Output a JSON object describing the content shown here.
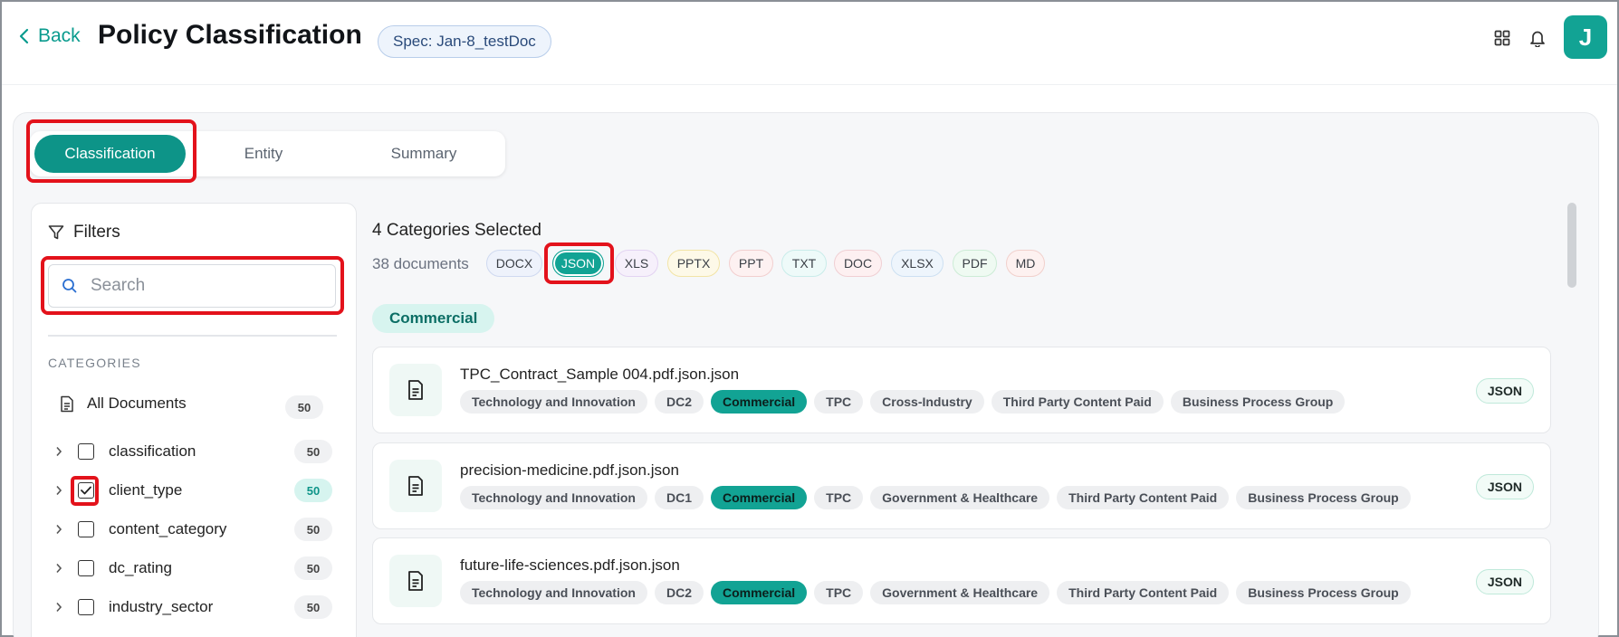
{
  "header": {
    "back_label": "Back",
    "title": "Policy Classification",
    "spec_chip": "Spec: Jan-8_testDoc",
    "avatar_initial": "J",
    "icons": [
      "grid-icon",
      "bell-icon"
    ]
  },
  "tabs": [
    {
      "label": "Classification",
      "active": true
    },
    {
      "label": "Entity",
      "active": false
    },
    {
      "label": "Summary",
      "active": false
    }
  ],
  "filters": {
    "title": "Filters",
    "search_placeholder": "Search",
    "categories_label": "CATEGORIES",
    "all_documents": {
      "label": "All Documents",
      "count": "50"
    },
    "items": [
      {
        "label": "classification",
        "count": "50",
        "checked": false
      },
      {
        "label": "client_type",
        "count": "50",
        "checked": true
      },
      {
        "label": "content_category",
        "count": "50",
        "checked": false
      },
      {
        "label": "dc_rating",
        "count": "50",
        "checked": false
      },
      {
        "label": "industry_sector",
        "count": "50",
        "checked": false
      }
    ]
  },
  "content": {
    "categories_selected": "4 Categories Selected",
    "doc_count": "38 documents",
    "file_types": [
      {
        "label": "DOCX",
        "selected": false,
        "bg": "#eef2fb",
        "border": "#cfd9f0"
      },
      {
        "label": "JSON",
        "selected": true,
        "bg": "#12a394",
        "border": "#12a394"
      },
      {
        "label": "XLS",
        "selected": false,
        "bg": "#f6f0fb",
        "border": "#e3d3f2"
      },
      {
        "label": "PPTX",
        "selected": false,
        "bg": "#fdf9e8",
        "border": "#f2e4a6"
      },
      {
        "label": "PPT",
        "selected": false,
        "bg": "#fdf1f1",
        "border": "#f2cfcf"
      },
      {
        "label": "TXT",
        "selected": false,
        "bg": "#eefaf9",
        "border": "#c9ecea"
      },
      {
        "label": "DOC",
        "selected": false,
        "bg": "#fdf0f1",
        "border": "#f0cfd3"
      },
      {
        "label": "XLSX",
        "selected": false,
        "bg": "#eef5fc",
        "border": "#cde0f2"
      },
      {
        "label": "PDF",
        "selected": false,
        "bg": "#effaf2",
        "border": "#cdecd6"
      },
      {
        "label": "MD",
        "selected": false,
        "bg": "#fdf1f0",
        "border": "#f1d0cc"
      }
    ],
    "group_label": "Commercial",
    "documents": [
      {
        "name": "TPC_Contract_Sample 004.pdf.json.json",
        "tags": [
          "Technology and Innovation",
          "DC2",
          "Commercial",
          "TPC",
          "Cross-Industry",
          "Third Party Content Paid",
          "Business Process Group"
        ],
        "format": "JSON"
      },
      {
        "name": "precision-medicine.pdf.json.json",
        "tags": [
          "Technology and Innovation",
          "DC1",
          "Commercial",
          "TPC",
          "Government & Healthcare",
          "Third Party Content Paid",
          "Business Process Group"
        ],
        "format": "JSON"
      },
      {
        "name": "future-life-sciences.pdf.json.json",
        "tags": [
          "Technology and Innovation",
          "DC2",
          "Commercial",
          "TPC",
          "Government & Healthcare",
          "Third Party Content Paid",
          "Business Process Group"
        ],
        "format": "JSON"
      }
    ]
  },
  "colors": {
    "accent": "#0d9488",
    "highlight": "#e3121b"
  }
}
